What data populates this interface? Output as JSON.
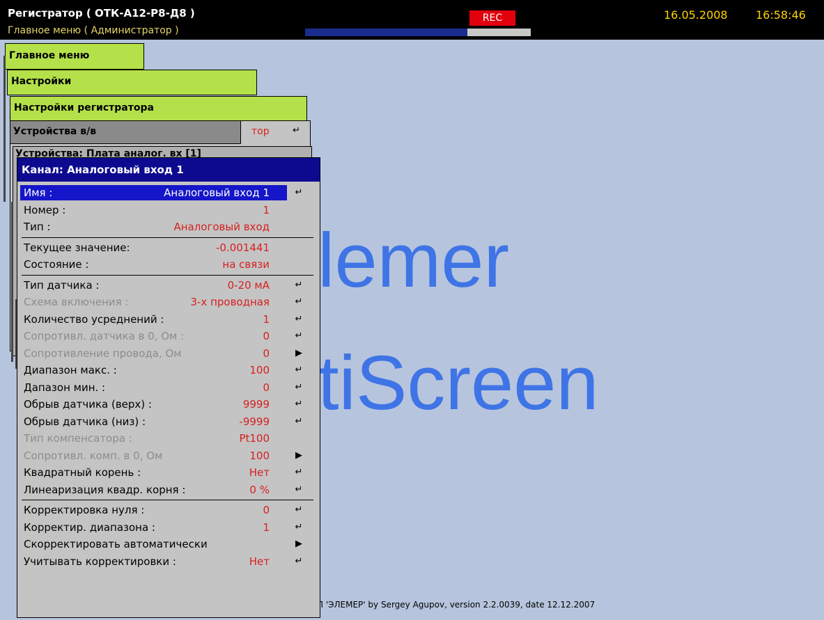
{
  "topbar": {
    "title": "Регистратор ( ОТК-А12-Р8-Д8 )",
    "menu_path": "Главное меню ( Администратор )",
    "rec_label": "REC",
    "progress": 0.72,
    "date": "16.05.2008",
    "time": "16:58:46"
  },
  "background": {
    "logo_line1": "lemer",
    "logo_line2": "tiScreen",
    "footer": "П 'ЭЛЕМЕР' by Sergey Agupov, version 2.2.0039, date 12.12.2007"
  },
  "windows": {
    "w1_title": "Главное меню",
    "w2_title": "Настройки",
    "w3_title": "Настройки регистратора",
    "w4_title": "Устройства в/в",
    "w4_peek": "тор",
    "w5_title": "Устройства: Плата аналог. вх [1]"
  },
  "main": {
    "title": "Канал: Аналоговый вход 1",
    "fields": [
      {
        "label": "Имя :",
        "value": "Аналоговый вход 1",
        "action": "enter",
        "selected": true
      },
      {
        "label": "Номер :",
        "value": "1",
        "action": ""
      },
      {
        "label": "Тип :",
        "value": "Аналоговый вход",
        "action": ""
      },
      {
        "separator": true
      },
      {
        "label": "Текущее значение:",
        "value": "-0.001441",
        "action": ""
      },
      {
        "label": "Состояние :",
        "value": "на связи",
        "action": ""
      },
      {
        "separator": true
      },
      {
        "label": "Тип датчика :",
        "value": "0-20 мА",
        "action": "enter"
      },
      {
        "label": "Схема включения :",
        "value": "3-х проводная",
        "action": "enter",
        "disabled": true
      },
      {
        "label": "Количество усреднений :",
        "value": "1",
        "action": "enter"
      },
      {
        "label": "Сопротивл. датчика в 0, Ом :",
        "value": "0",
        "action": "enter",
        "disabled": true
      },
      {
        "label": "Сопротивление провода, Ом",
        "value": "0",
        "action": "arrow",
        "disabled": true
      },
      {
        "label": "Диапазон макс. :",
        "value": "100",
        "action": "enter"
      },
      {
        "label": "Дапазон мин. :",
        "value": "0",
        "action": "enter"
      },
      {
        "label": "Обрыв датчика (верх) :",
        "value": "9999",
        "action": "enter"
      },
      {
        "label": "Обрыв датчика (низ) :",
        "value": "-9999",
        "action": "enter"
      },
      {
        "label": "Тип компенсатора :",
        "value": "Pt100",
        "action": "",
        "disabled": true
      },
      {
        "label": "Сопротивл. комп. в 0, Ом",
        "value": "100",
        "action": "arrow",
        "disabled": true
      },
      {
        "label": "Квадратный корень :",
        "value": "Нет",
        "action": "enter"
      },
      {
        "label": "Линеаризация квадр. корня :",
        "value": "0 %",
        "action": "enter"
      },
      {
        "separator": true
      },
      {
        "label": "Корректировка нуля :",
        "value": "0",
        "action": "enter"
      },
      {
        "label": "Корректир. диапазона :",
        "value": "1",
        "action": "enter"
      },
      {
        "label": "Скорректировать автоматически",
        "value": "",
        "action": "arrow"
      },
      {
        "label": "Учитывать корректировки :",
        "value": "Нет",
        "action": "enter"
      }
    ]
  },
  "icons": {
    "enter": "enter-return-icon",
    "arrow": "right-arrow-icon"
  },
  "colors": {
    "value_red": "#d81f1f",
    "selection_blue": "#1515c9",
    "title_navy": "#0d0a8f",
    "menu_green": "#b4e04a"
  }
}
